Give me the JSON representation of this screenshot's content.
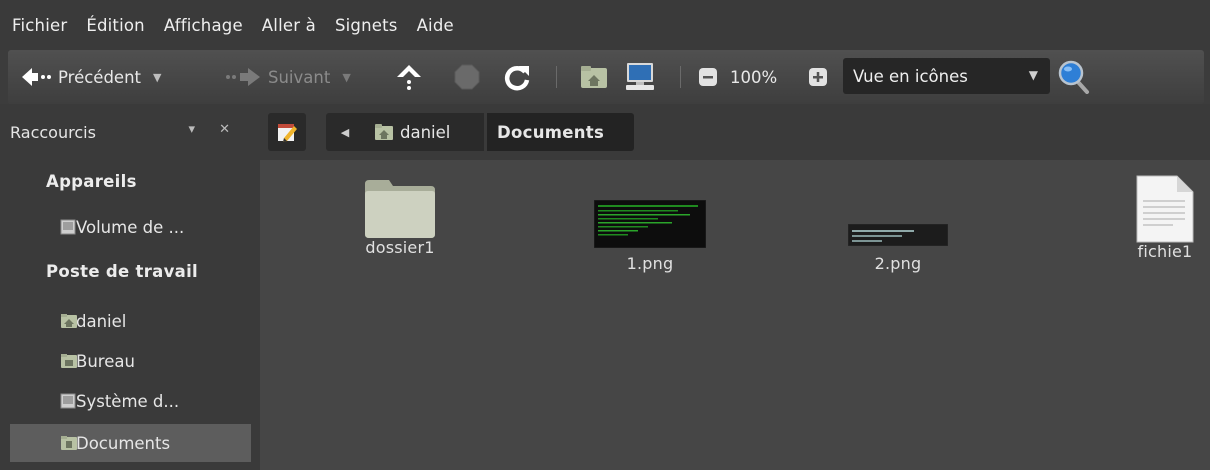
{
  "menubar": {
    "items": [
      "Fichier",
      "Édition",
      "Affichage",
      "Aller à",
      "Signets",
      "Aide"
    ]
  },
  "toolbar": {
    "back_label": "Précédent",
    "forward_label": "Suivant",
    "zoom_level": "100%",
    "view_mode": "Vue en icônes"
  },
  "sidebar_header": {
    "title": "Raccourcis",
    "controls": "▾ ✕"
  },
  "pathbar": {
    "crumbs": [
      "daniel",
      "Documents"
    ]
  },
  "sidebar": {
    "sections": [
      {
        "caption": "Appareils"
      },
      {
        "caption": "Poste de travail"
      }
    ],
    "items": [
      {
        "label": "Volume de ..."
      },
      {
        "label": "daniel"
      },
      {
        "label": "Bureau"
      },
      {
        "label": "Système d..."
      },
      {
        "label": "Documents"
      }
    ]
  },
  "files": [
    {
      "name": "dossier1",
      "type": "folder"
    },
    {
      "name": "1.png",
      "type": "image"
    },
    {
      "name": "2.png",
      "type": "image"
    },
    {
      "name": "fichie1",
      "type": "text-file"
    }
  ],
  "colors": {
    "accent_blue": "#3d8bd9",
    "selection": "#5d5d5d",
    "background": "#3c3c3c"
  }
}
